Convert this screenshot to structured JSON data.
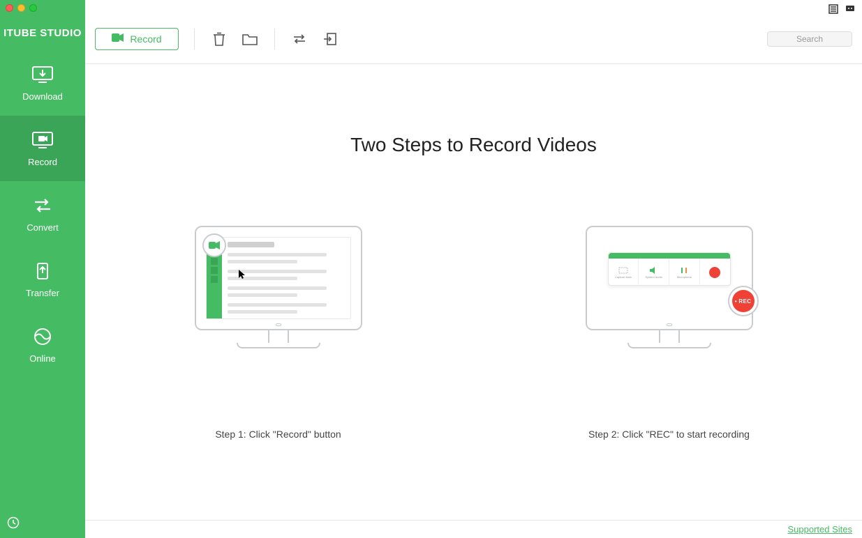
{
  "app_title": "ITUBE STUDIO",
  "sidebar": {
    "items": [
      {
        "label": "Download",
        "icon": "download-icon",
        "active": false
      },
      {
        "label": "Record",
        "icon": "record-screen-icon",
        "active": true
      },
      {
        "label": "Convert",
        "icon": "convert-icon",
        "active": false
      },
      {
        "label": "Transfer",
        "icon": "transfer-icon",
        "active": false
      },
      {
        "label": "Online",
        "icon": "globe-icon",
        "active": false
      }
    ]
  },
  "toolbar": {
    "record_label": "Record",
    "icons": [
      "trash-icon",
      "folder-icon",
      "loop-icon",
      "import-icon"
    ]
  },
  "search": {
    "placeholder": "Search"
  },
  "titlebar_icons": [
    "list-icon",
    "feedback-icon"
  ],
  "content": {
    "heading": "Two Steps to Record Videos",
    "step1_caption": "Step 1: Click \"Record\" button",
    "step2_caption": "Step 2: Click \"REC\" to start recording",
    "rec_toolbar_cells": [
      "Capture Area",
      "System Audio",
      "Microphone"
    ],
    "rec_badge_label": "• REC"
  },
  "footer": {
    "supported_sites": "Supported Sites"
  },
  "colors": {
    "brand": "#45bb63",
    "brand_dark": "#3aa556",
    "rec_red": "#ef4136"
  }
}
